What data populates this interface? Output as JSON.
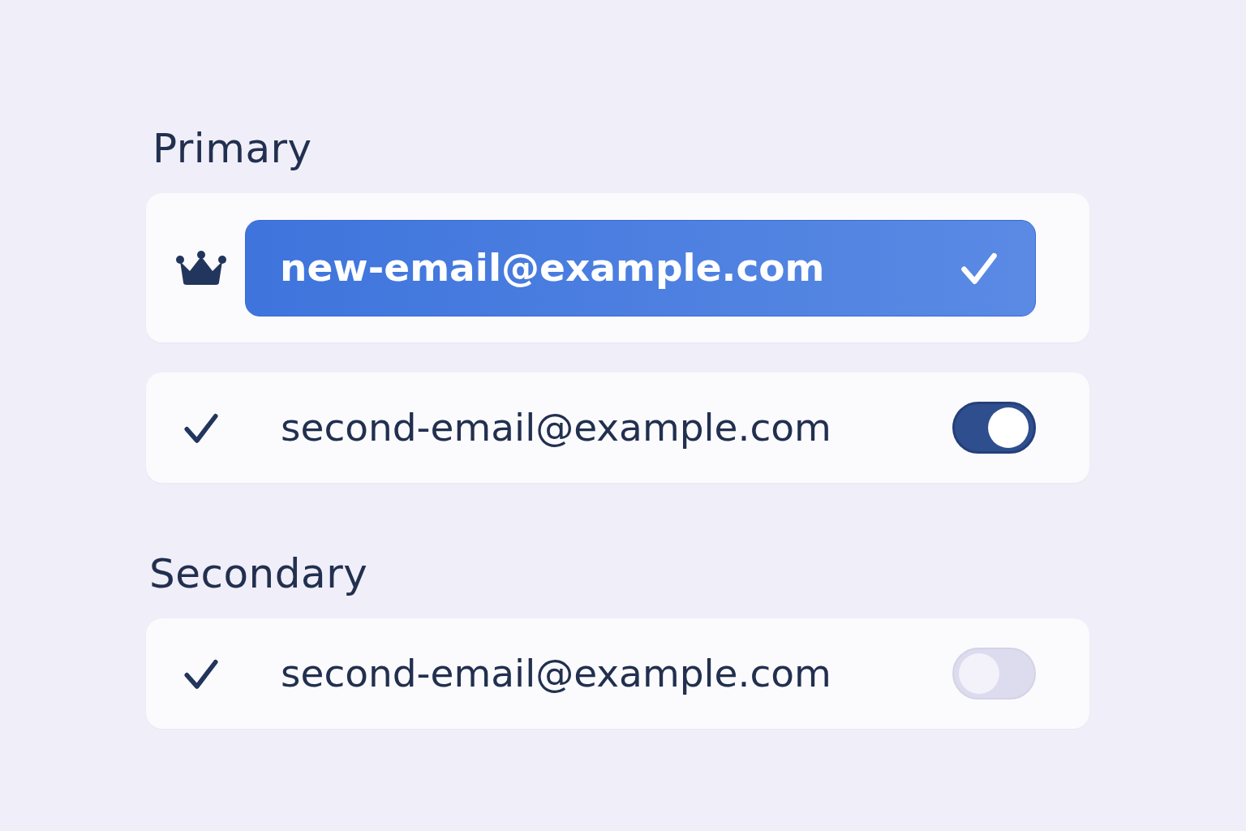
{
  "sections": [
    {
      "title": "Primary",
      "rows": [
        {
          "kind": "primary",
          "email": "new-email@example.com",
          "selected": true
        },
        {
          "kind": "toggle",
          "email": "second-email@example.com",
          "on": true
        }
      ]
    },
    {
      "title": "Secondary",
      "rows": [
        {
          "kind": "toggle",
          "email": "second-email@example.com",
          "on": false
        }
      ]
    }
  ]
}
